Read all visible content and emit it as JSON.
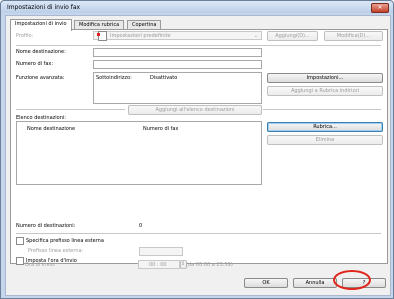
{
  "window": {
    "title": "Impostazioni di invio fax",
    "close": "✕"
  },
  "tabs": [
    {
      "label": "Impostazioni di invio"
    },
    {
      "label": "Modifica rubrica"
    },
    {
      "label": "Copertina"
    }
  ],
  "profile": {
    "label": "Profilo:",
    "value": "Impostazioni predefinite",
    "add_button": "Aggiungi(D)...",
    "modify_button": "Modifica(D)..."
  },
  "fields": {
    "name_label": "Nome destinazione:",
    "fax_label": "Numero di fax:",
    "advanced_label": "Funzione avanzata:",
    "subaddress_label": "Sottoindirizzo:",
    "subaddress_value": "Disattivato"
  },
  "buttons": {
    "settings": "Impostazioni...",
    "add_to_addressbook": "Aggiungi a Rubrica indirizzi",
    "add_to_list": "Aggiungi all'elenco destinazioni",
    "addressbook": "Rubrica...",
    "delete": "Elimina",
    "ok": "OK",
    "cancel": "Annulla",
    "help": "?"
  },
  "destinations": {
    "label": "Elenco destinazioni:",
    "col_name": "Nome destinazione",
    "col_fax": "Numero di fax",
    "count_label": "Numero di destinazioni:",
    "count_value": "0"
  },
  "options": {
    "external_prefix_check": "Specifica prefisso linea esterna",
    "external_prefix_label": "Prefisso linea esterna:",
    "send_time_check": "Imposta l'ora d'invio",
    "send_time_label": "Ora di invio:",
    "send_time_value": "00 : 00",
    "send_time_range": "(da 00:00 a 23:59)"
  }
}
